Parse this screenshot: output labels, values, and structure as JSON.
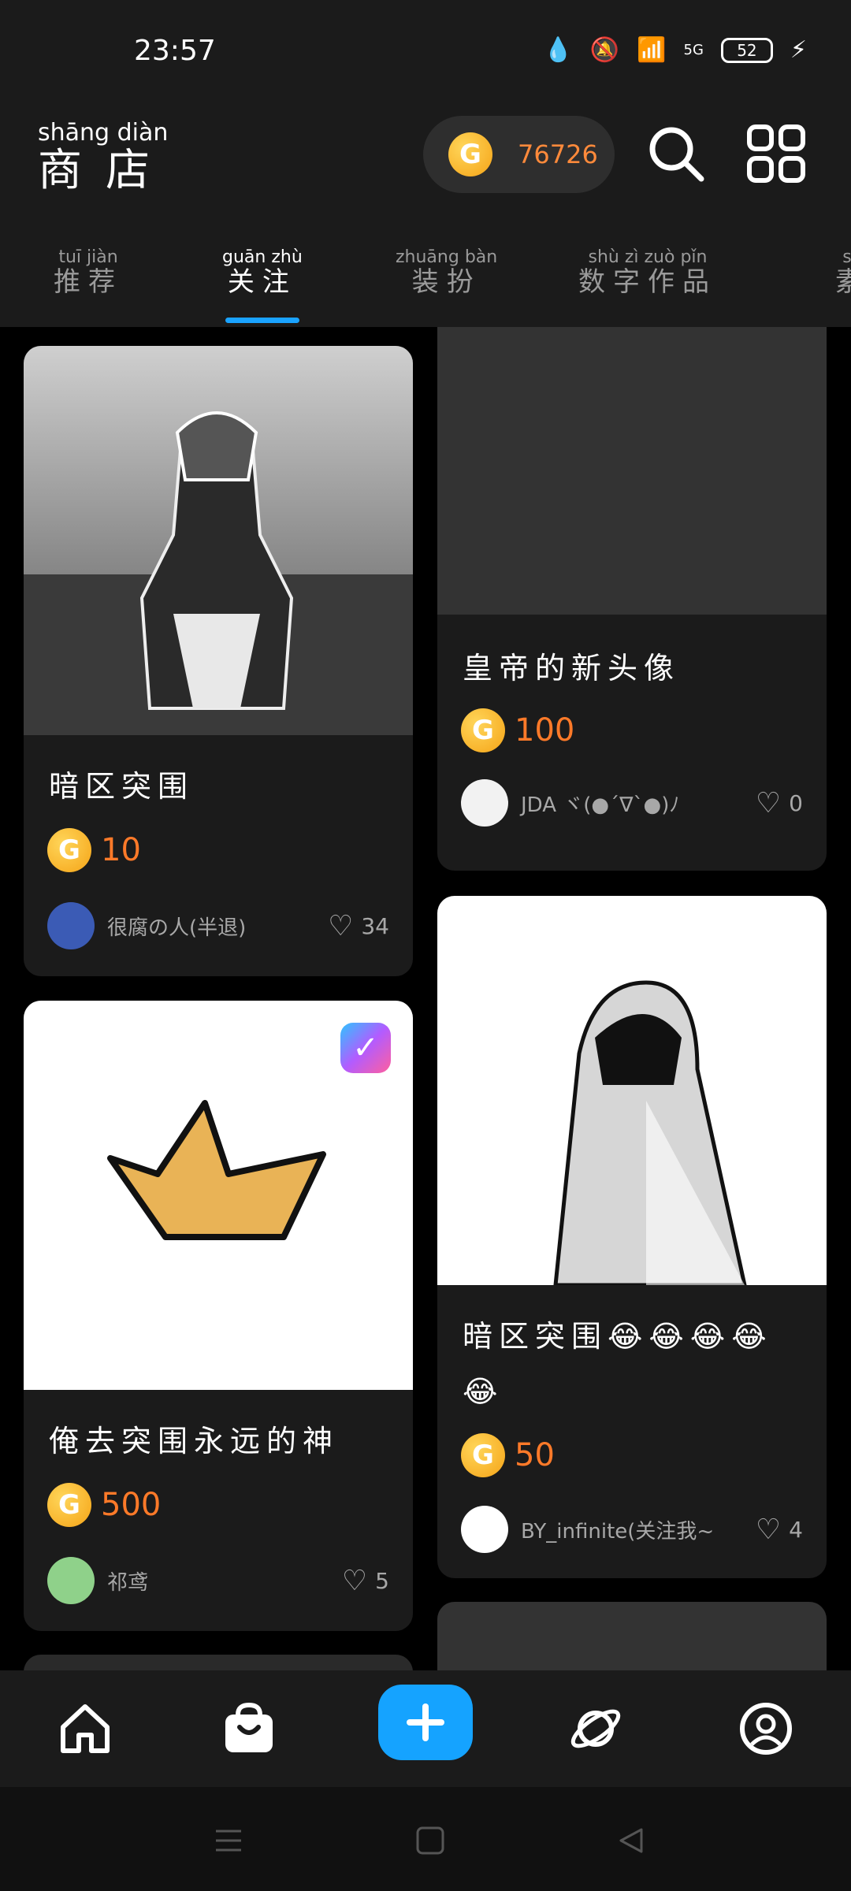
{
  "status": {
    "time": "23:57",
    "battery": "52",
    "network": "5G"
  },
  "header": {
    "title_pinyin": "shāng diàn",
    "title": "商店",
    "coin_count": "76726",
    "coin_symbol": "G"
  },
  "tabs": [
    {
      "pinyin": "tuī jiàn",
      "label": "推荐",
      "active": false
    },
    {
      "pinyin": "guān zhù",
      "label": "关注",
      "active": true
    },
    {
      "pinyin": "zhuāng bàn",
      "label": "装扮",
      "active": false
    },
    {
      "pinyin": "shù zì zuò pǐn",
      "label": "数字作品",
      "active": false
    },
    {
      "pinyin": "sù",
      "label": "素",
      "active": false
    }
  ],
  "cards": [
    {
      "title": "暗区突围",
      "price": "10",
      "user": "很腐の人(半退)",
      "likes": "34"
    },
    {
      "title": "皇帝的新头像",
      "price": "100",
      "user": "JDA ヾ(●´∇`●)ﾉ",
      "likes": "0"
    },
    {
      "title": "俺去突围永远的神",
      "price": "500",
      "user": "祁鸢",
      "likes": "5"
    },
    {
      "title": "暗区突围😂😂😂😂😂",
      "price": "50",
      "user": "BY_infinite(关注我~",
      "likes": "4"
    }
  ],
  "bottom_nav": [
    "home",
    "shop",
    "add",
    "planet",
    "profile"
  ],
  "colors": {
    "accent": "#1aa3ff",
    "price": "#ff7a29",
    "coin": "#f5a316"
  }
}
